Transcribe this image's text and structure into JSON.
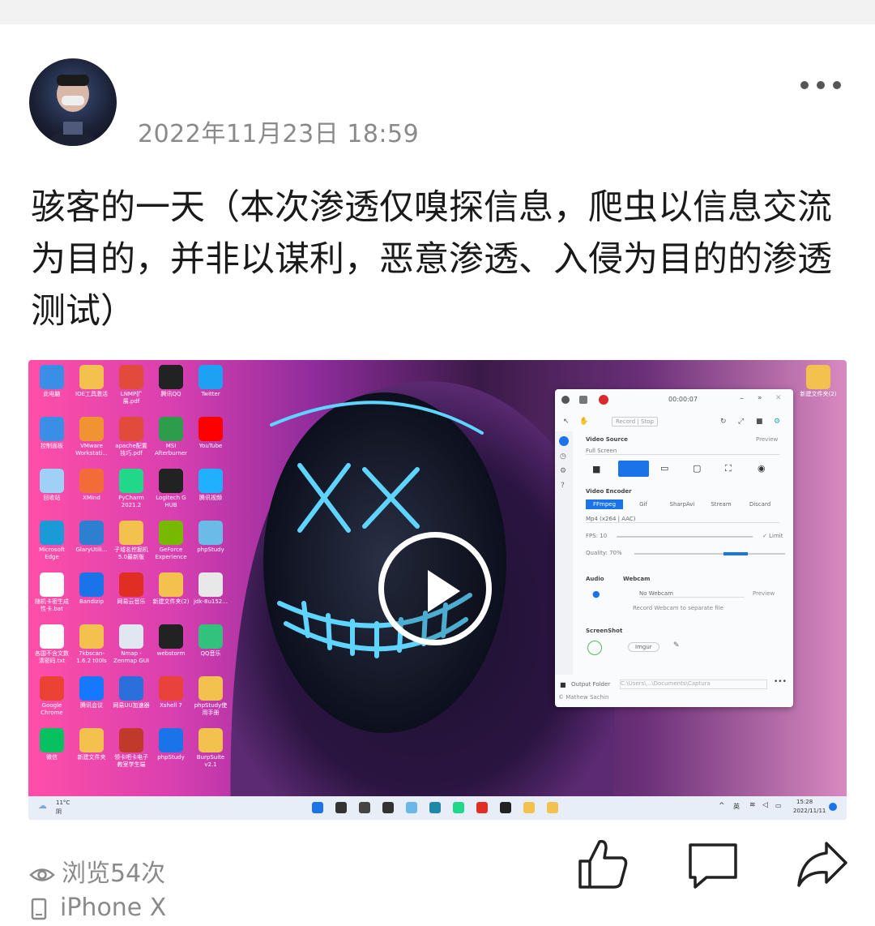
{
  "post": {
    "timestamp": "2022年11月23日 18:59",
    "title": "骇客的一天（本次渗透仅嗅探信息，爬虫以信息交流为目的，并非以谋利，恶意渗透、入侵为目的的渗透测试）",
    "views": "浏览54次",
    "device": "iPhone X"
  },
  "desktop_icons": [
    {
      "label": "此电脑",
      "color": "#3a8ee6"
    },
    {
      "label": "IOE工具激活",
      "color": "#f2c14e"
    },
    {
      "label": "LNMP扩展.pdf",
      "color": "#e14b3b"
    },
    {
      "label": "腾讯QQ",
      "color": "#222222"
    },
    {
      "label": "Twitter",
      "color": "#1da1f2"
    },
    {
      "label": "控制面板",
      "color": "#3a8ee6"
    },
    {
      "label": "VMware Workstati...",
      "color": "#f09433"
    },
    {
      "label": "apache配置技巧.pdf",
      "color": "#e14b3b"
    },
    {
      "label": "MSI Afterburner",
      "color": "#2c9e4b"
    },
    {
      "label": "YouTube",
      "color": "#ff0000"
    },
    {
      "label": "回收站",
      "color": "#9fd0f5"
    },
    {
      "label": "XMind",
      "color": "#f26b38"
    },
    {
      "label": "PyCharm 2021.2",
      "color": "#21d789"
    },
    {
      "label": "Logitech G HUB",
      "color": "#222222"
    },
    {
      "label": "腾讯视频",
      "color": "#20b0ff"
    },
    {
      "label": "Microsoft Edge",
      "color": "#1a9ad6"
    },
    {
      "label": "GlaryUtili...",
      "color": "#2d7fd1"
    },
    {
      "label": "子域名挖掘机5.0最新版",
      "color": "#f2c14e"
    },
    {
      "label": "GeForce Experience",
      "color": "#76b900"
    },
    {
      "label": "phpStudy",
      "color": "#6bbbe8"
    },
    {
      "label": "随机卡密生成 性卡.bat",
      "color": "#ffffff"
    },
    {
      "label": "Bandizip",
      "color": "#1a73e8"
    },
    {
      "label": "网易云音乐",
      "color": "#e02e24"
    },
    {
      "label": "新建文件夹(2)",
      "color": "#f2c14e"
    },
    {
      "label": "jdk-8u152...",
      "color": "#e8e8e8"
    },
    {
      "label": "各国不含文数 清密码.txt",
      "color": "#ffffff"
    },
    {
      "label": "7kbscan-1.6.2 t00ls",
      "color": "#f2c14e"
    },
    {
      "label": "Nmap - Zenmap GUI",
      "color": "#dfe7f0"
    },
    {
      "label": "webstorm",
      "color": "#222222"
    },
    {
      "label": "QQ音乐",
      "color": "#31c27c"
    },
    {
      "label": "Google Chrome",
      "color": "#ea4335"
    },
    {
      "label": "腾讯会议",
      "color": "#1677ff"
    },
    {
      "label": "网易UU加速器",
      "color": "#2a6fdb"
    },
    {
      "label": "Xshell 7",
      "color": "#e8423b"
    },
    {
      "label": "phpStudy使用手册",
      "color": "#f2c14e"
    },
    {
      "label": "微信",
      "color": "#07c160"
    },
    {
      "label": "新建文件夹",
      "color": "#f2c14e"
    },
    {
      "label": "领卡吧卡电子教室学生端",
      "color": "#c0392b"
    },
    {
      "label": "phpStudy",
      "color": "#1a73e8"
    },
    {
      "label": "BurpSuite v2.1",
      "color": "#f2c14e"
    }
  ],
  "desktop_right_icon": {
    "label": "新建文件夹(2)"
  },
  "recorder": {
    "time": "00:00:07",
    "record_label": "Record | Stop",
    "video_source_label": "Video Source",
    "preview_label": "Preview",
    "source_value": "Full Screen",
    "video_encoder_label": "Video Encoder",
    "encoder_tabs": [
      "FFmpeg",
      "Gif",
      "SharpAvi",
      "Stream",
      "Discard"
    ],
    "codec": "Mp4 (x264 | AAC)",
    "fps_label": "FPS: 10",
    "limit_label": "Limit",
    "quality_label": "Quality: 70%",
    "audio_label": "Audio",
    "webcam_label": "Webcam",
    "webcam_value": "No Webcam",
    "webcam_preview": "Preview",
    "separate_label": "Record Webcam to separate file",
    "screenshot_label": "ScreenShot",
    "imgur_label": "Imgur",
    "output_label": "Output Folder",
    "output_path": "C:\\Users\\...\\Documents\\Captura",
    "author": "© Mathew Sachin"
  },
  "taskbar": {
    "weather_temp": "11°C",
    "weather_desc": "阴",
    "ime": "英",
    "clock_time": "15:28",
    "clock_date": "2022/11/11"
  },
  "colors": {
    "timestamp": "#8a8a8a",
    "title": "#1a1a1a",
    "accent": "#1677ff"
  }
}
